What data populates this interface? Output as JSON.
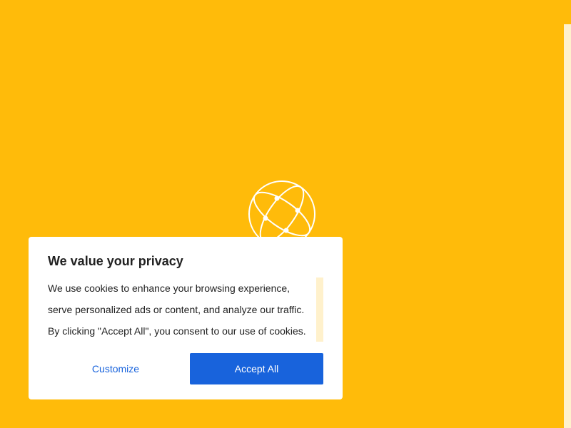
{
  "page": {
    "background_color": "#ffbb0a",
    "icon": "globe-network-icon"
  },
  "consent": {
    "title": "We value your privacy",
    "body_lines": [
      "We use cookies to enhance your browsing experience,",
      "serve personalized ads or content, and analyze our traffic.",
      "By clicking \"Accept All\", you consent to our use of cookies."
    ],
    "customize_label": "Customize",
    "accept_label": "Accept All",
    "accent_color": "#1863dc"
  }
}
